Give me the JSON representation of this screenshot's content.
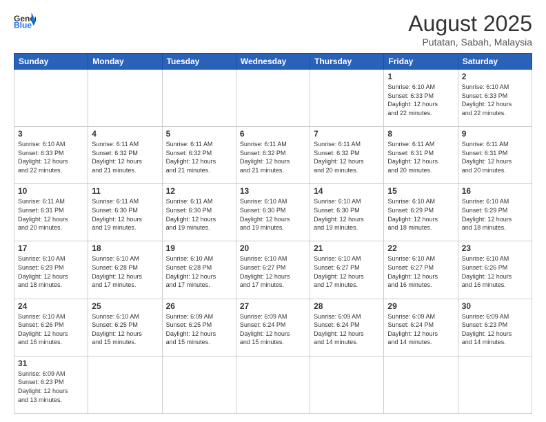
{
  "header": {
    "logo_general": "General",
    "logo_blue": "Blue",
    "month_title": "August 2025",
    "location": "Putatan, Sabah, Malaysia"
  },
  "weekdays": [
    "Sunday",
    "Monday",
    "Tuesday",
    "Wednesday",
    "Thursday",
    "Friday",
    "Saturday"
  ],
  "weeks": [
    [
      {
        "day": "",
        "info": ""
      },
      {
        "day": "",
        "info": ""
      },
      {
        "day": "",
        "info": ""
      },
      {
        "day": "",
        "info": ""
      },
      {
        "day": "",
        "info": ""
      },
      {
        "day": "1",
        "info": "Sunrise: 6:10 AM\nSunset: 6:33 PM\nDaylight: 12 hours\nand 22 minutes."
      },
      {
        "day": "2",
        "info": "Sunrise: 6:10 AM\nSunset: 6:33 PM\nDaylight: 12 hours\nand 22 minutes."
      }
    ],
    [
      {
        "day": "3",
        "info": "Sunrise: 6:10 AM\nSunset: 6:33 PM\nDaylight: 12 hours\nand 22 minutes."
      },
      {
        "day": "4",
        "info": "Sunrise: 6:11 AM\nSunset: 6:32 PM\nDaylight: 12 hours\nand 21 minutes."
      },
      {
        "day": "5",
        "info": "Sunrise: 6:11 AM\nSunset: 6:32 PM\nDaylight: 12 hours\nand 21 minutes."
      },
      {
        "day": "6",
        "info": "Sunrise: 6:11 AM\nSunset: 6:32 PM\nDaylight: 12 hours\nand 21 minutes."
      },
      {
        "day": "7",
        "info": "Sunrise: 6:11 AM\nSunset: 6:32 PM\nDaylight: 12 hours\nand 20 minutes."
      },
      {
        "day": "8",
        "info": "Sunrise: 6:11 AM\nSunset: 6:31 PM\nDaylight: 12 hours\nand 20 minutes."
      },
      {
        "day": "9",
        "info": "Sunrise: 6:11 AM\nSunset: 6:31 PM\nDaylight: 12 hours\nand 20 minutes."
      }
    ],
    [
      {
        "day": "10",
        "info": "Sunrise: 6:11 AM\nSunset: 6:31 PM\nDaylight: 12 hours\nand 20 minutes."
      },
      {
        "day": "11",
        "info": "Sunrise: 6:11 AM\nSunset: 6:30 PM\nDaylight: 12 hours\nand 19 minutes."
      },
      {
        "day": "12",
        "info": "Sunrise: 6:11 AM\nSunset: 6:30 PM\nDaylight: 12 hours\nand 19 minutes."
      },
      {
        "day": "13",
        "info": "Sunrise: 6:10 AM\nSunset: 6:30 PM\nDaylight: 12 hours\nand 19 minutes."
      },
      {
        "day": "14",
        "info": "Sunrise: 6:10 AM\nSunset: 6:30 PM\nDaylight: 12 hours\nand 19 minutes."
      },
      {
        "day": "15",
        "info": "Sunrise: 6:10 AM\nSunset: 6:29 PM\nDaylight: 12 hours\nand 18 minutes."
      },
      {
        "day": "16",
        "info": "Sunrise: 6:10 AM\nSunset: 6:29 PM\nDaylight: 12 hours\nand 18 minutes."
      }
    ],
    [
      {
        "day": "17",
        "info": "Sunrise: 6:10 AM\nSunset: 6:29 PM\nDaylight: 12 hours\nand 18 minutes."
      },
      {
        "day": "18",
        "info": "Sunrise: 6:10 AM\nSunset: 6:28 PM\nDaylight: 12 hours\nand 17 minutes."
      },
      {
        "day": "19",
        "info": "Sunrise: 6:10 AM\nSunset: 6:28 PM\nDaylight: 12 hours\nand 17 minutes."
      },
      {
        "day": "20",
        "info": "Sunrise: 6:10 AM\nSunset: 6:27 PM\nDaylight: 12 hours\nand 17 minutes."
      },
      {
        "day": "21",
        "info": "Sunrise: 6:10 AM\nSunset: 6:27 PM\nDaylight: 12 hours\nand 17 minutes."
      },
      {
        "day": "22",
        "info": "Sunrise: 6:10 AM\nSunset: 6:27 PM\nDaylight: 12 hours\nand 16 minutes."
      },
      {
        "day": "23",
        "info": "Sunrise: 6:10 AM\nSunset: 6:26 PM\nDaylight: 12 hours\nand 16 minutes."
      }
    ],
    [
      {
        "day": "24",
        "info": "Sunrise: 6:10 AM\nSunset: 6:26 PM\nDaylight: 12 hours\nand 16 minutes."
      },
      {
        "day": "25",
        "info": "Sunrise: 6:10 AM\nSunset: 6:25 PM\nDaylight: 12 hours\nand 15 minutes."
      },
      {
        "day": "26",
        "info": "Sunrise: 6:09 AM\nSunset: 6:25 PM\nDaylight: 12 hours\nand 15 minutes."
      },
      {
        "day": "27",
        "info": "Sunrise: 6:09 AM\nSunset: 6:24 PM\nDaylight: 12 hours\nand 15 minutes."
      },
      {
        "day": "28",
        "info": "Sunrise: 6:09 AM\nSunset: 6:24 PM\nDaylight: 12 hours\nand 14 minutes."
      },
      {
        "day": "29",
        "info": "Sunrise: 6:09 AM\nSunset: 6:24 PM\nDaylight: 12 hours\nand 14 minutes."
      },
      {
        "day": "30",
        "info": "Sunrise: 6:09 AM\nSunset: 6:23 PM\nDaylight: 12 hours\nand 14 minutes."
      }
    ],
    [
      {
        "day": "31",
        "info": "Sunrise: 6:09 AM\nSunset: 6:23 PM\nDaylight: 12 hours\nand 13 minutes."
      },
      {
        "day": "",
        "info": ""
      },
      {
        "day": "",
        "info": ""
      },
      {
        "day": "",
        "info": ""
      },
      {
        "day": "",
        "info": ""
      },
      {
        "day": "",
        "info": ""
      },
      {
        "day": "",
        "info": ""
      }
    ]
  ]
}
